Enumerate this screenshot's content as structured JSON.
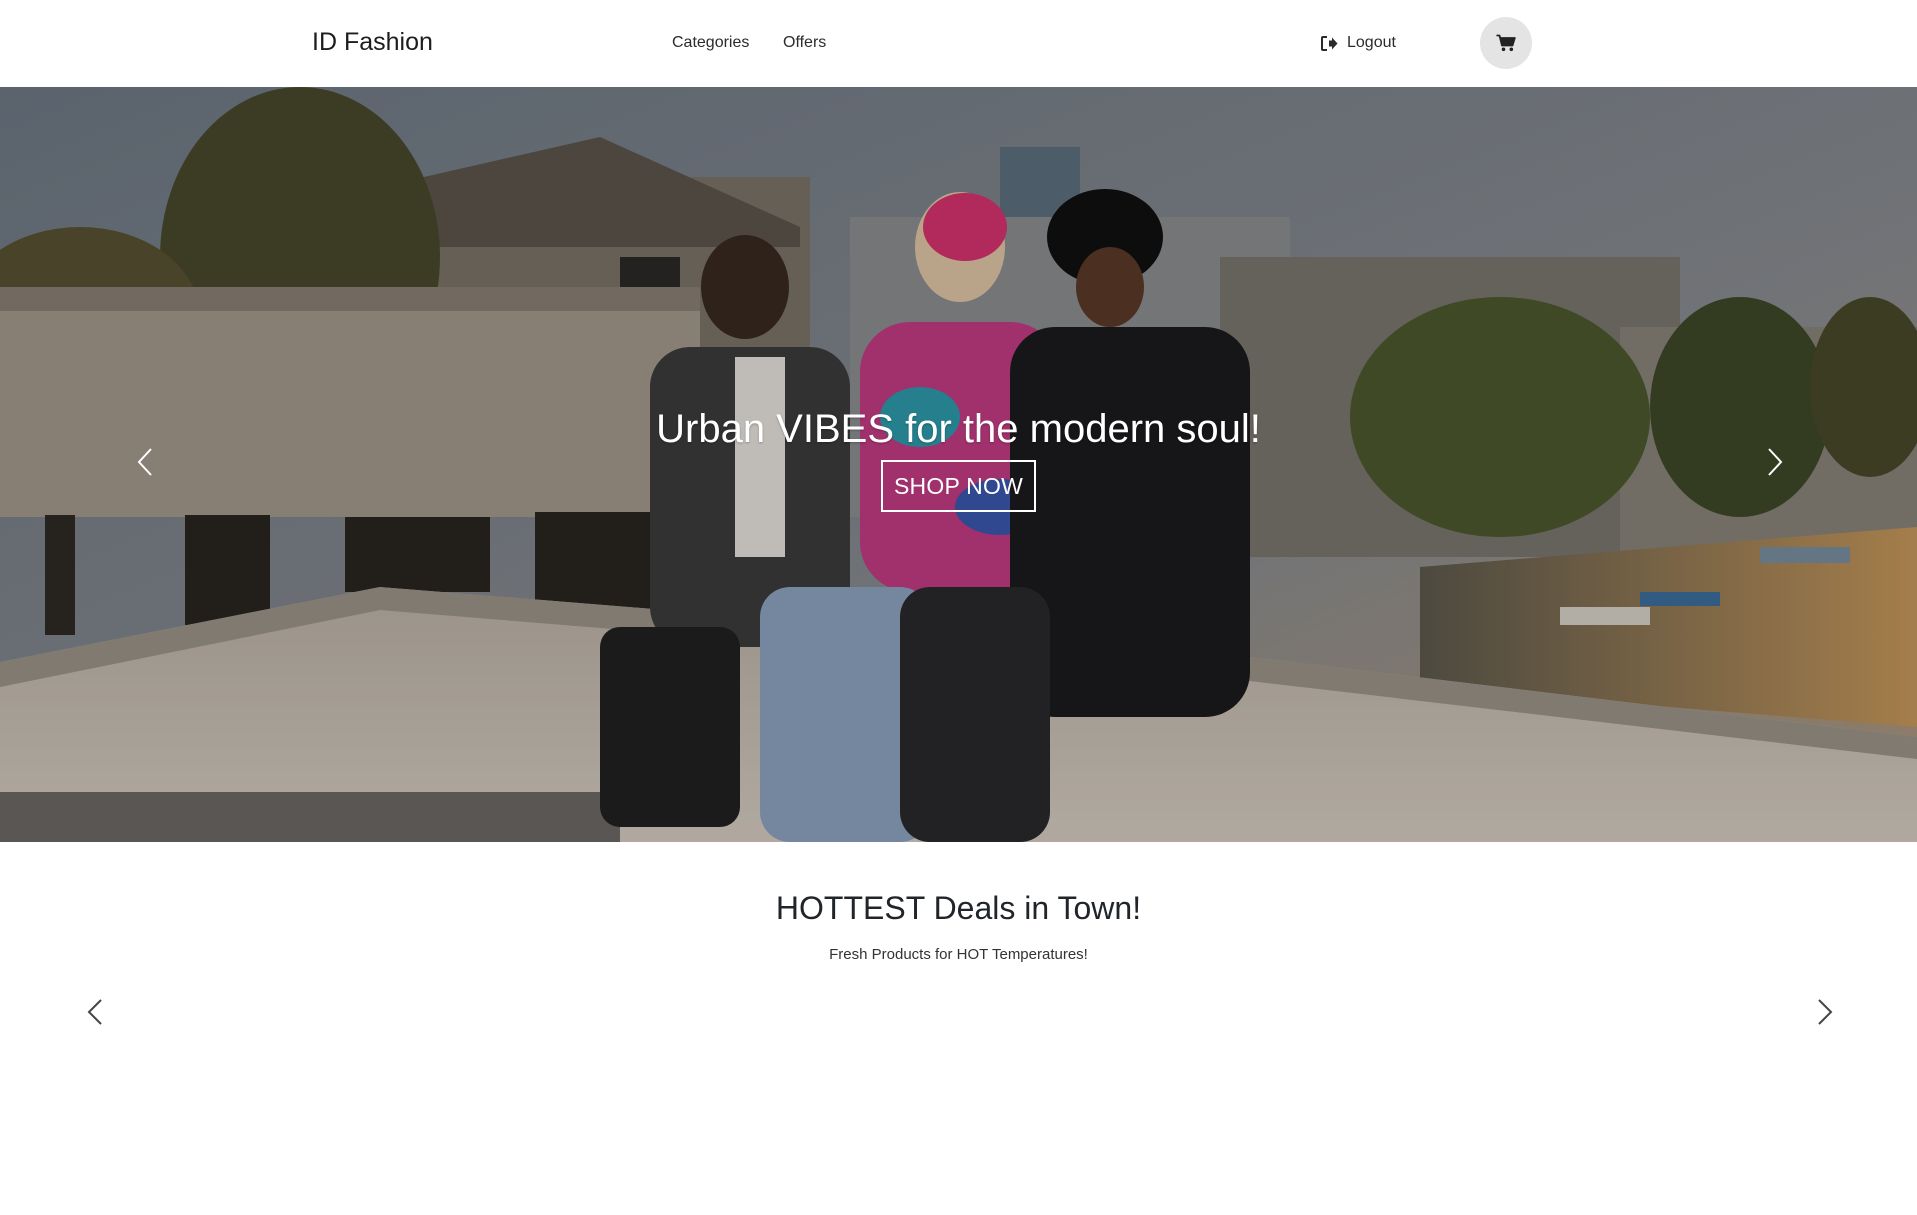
{
  "navbar": {
    "brand": "ID Fashion",
    "links": [
      {
        "label": "Categories"
      },
      {
        "label": "Offers"
      }
    ],
    "logout_label": "Logout",
    "cart_icon": "shopping-cart-icon"
  },
  "hero": {
    "title": "Urban VIBES for the modern soul!",
    "button_label": "SHOP NOW",
    "prev_icon": "chevron-left-icon",
    "next_icon": "chevron-right-icon"
  },
  "deals": {
    "title": "HOTTEST Deals in Town!",
    "subtitle": "Fresh Products for HOT Temperatures!",
    "prev_icon": "chevron-left-icon",
    "next_icon": "chevron-right-icon"
  },
  "colors": {
    "cart_button_bg": "#e4e4e4",
    "text_dark": "#212529",
    "hero_text": "#ffffff"
  }
}
